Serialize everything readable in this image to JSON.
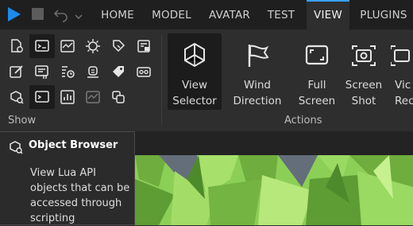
{
  "tabs": [
    {
      "label": "HOME",
      "active": false
    },
    {
      "label": "MODEL",
      "active": false
    },
    {
      "label": "AVATAR",
      "active": false
    },
    {
      "label": "TEST",
      "active": false
    },
    {
      "label": "VIEW",
      "active": true
    },
    {
      "label": "PLUGINS",
      "active": false
    }
  ],
  "quick_access": [
    "play-icon",
    "stop-icon",
    "undo-icon",
    "redo-icon"
  ],
  "show_group": {
    "label": "Show",
    "icons": [
      "explorer-icon",
      "output-icon",
      "performance-icon",
      "script-analysis-icon",
      "tag-editor-icon",
      "properties-lock-icon",
      "edit-icon",
      "command-bar-icon",
      "task-scheduler-icon",
      "terrain-icon",
      "tags-icon",
      "camera-icon",
      "object-browser-icon",
      "command-line-icon",
      "stats-icon",
      "render-icon",
      "teams-icon"
    ]
  },
  "actions_group": {
    "label": "Actions",
    "buttons": [
      {
        "line1": "View",
        "line2": "Selector",
        "icon": "view-selector-icon",
        "selected": true
      },
      {
        "line1": "Wind",
        "line2": "Direction",
        "icon": "wind-direction-icon",
        "selected": false
      },
      {
        "line1": "Full",
        "line2": "Screen",
        "icon": "full-screen-icon",
        "selected": false
      },
      {
        "line1": "Screen",
        "line2": "Shot",
        "icon": "screenshot-icon",
        "selected": false
      },
      {
        "line1": "Vic",
        "line2": "Rec",
        "icon": "video-record-icon",
        "selected": false
      }
    ]
  },
  "tooltip": {
    "title": "Object Browser",
    "description": "View Lua API objects that can be accessed through scripting"
  },
  "colors": {
    "accent": "#3aa0ff",
    "ribbon_bg": "#2e2e2e",
    "topbar_bg": "#1f1f1f",
    "terrain": "#7cc24d"
  }
}
